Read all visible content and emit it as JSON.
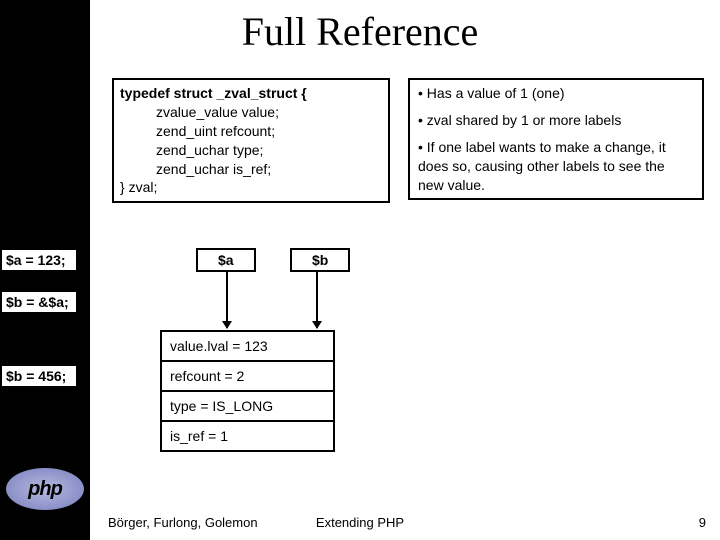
{
  "title": "Full Reference",
  "code": {
    "l1": "typedef struct _zval_struct {",
    "l2": "zvalue_value value;",
    "l3": "zend_uint refcount;",
    "l4": "zend_uchar type;",
    "l5": "zend_uchar is_ref;",
    "l6": "} zval;"
  },
  "bullets": {
    "b1": "• Has a value of 1 (one)",
    "b2": "• zval shared by 1 or more labels",
    "b3": "• If one label wants to make a change, it does so, causing other labels to see the new value."
  },
  "side": {
    "s1": "$a = 123;",
    "s2": "$b = &$a;",
    "s3": "$b = 456;"
  },
  "vars": {
    "a": "$a",
    "b": "$b"
  },
  "zval": {
    "r1": "value.lval = 123",
    "r2": "refcount = 2",
    "r3": "type = IS_LONG",
    "r4": "is_ref = 1"
  },
  "footer": {
    "authors": "Börger, Furlong, Golemon",
    "center": "Extending PHP",
    "page": "9"
  },
  "logo": "php",
  "chart_data": {
    "type": "table",
    "title": "zval struct state after $b = &$a",
    "rows": [
      {
        "field": "value.lval",
        "value": 123
      },
      {
        "field": "refcount",
        "value": 2
      },
      {
        "field": "type",
        "value": "IS_LONG"
      },
      {
        "field": "is_ref",
        "value": 1
      }
    ],
    "labels_pointing": [
      "$a",
      "$b"
    ],
    "statements": [
      "$a = 123;",
      "$b = &$a;",
      "$b = 456;"
    ]
  }
}
